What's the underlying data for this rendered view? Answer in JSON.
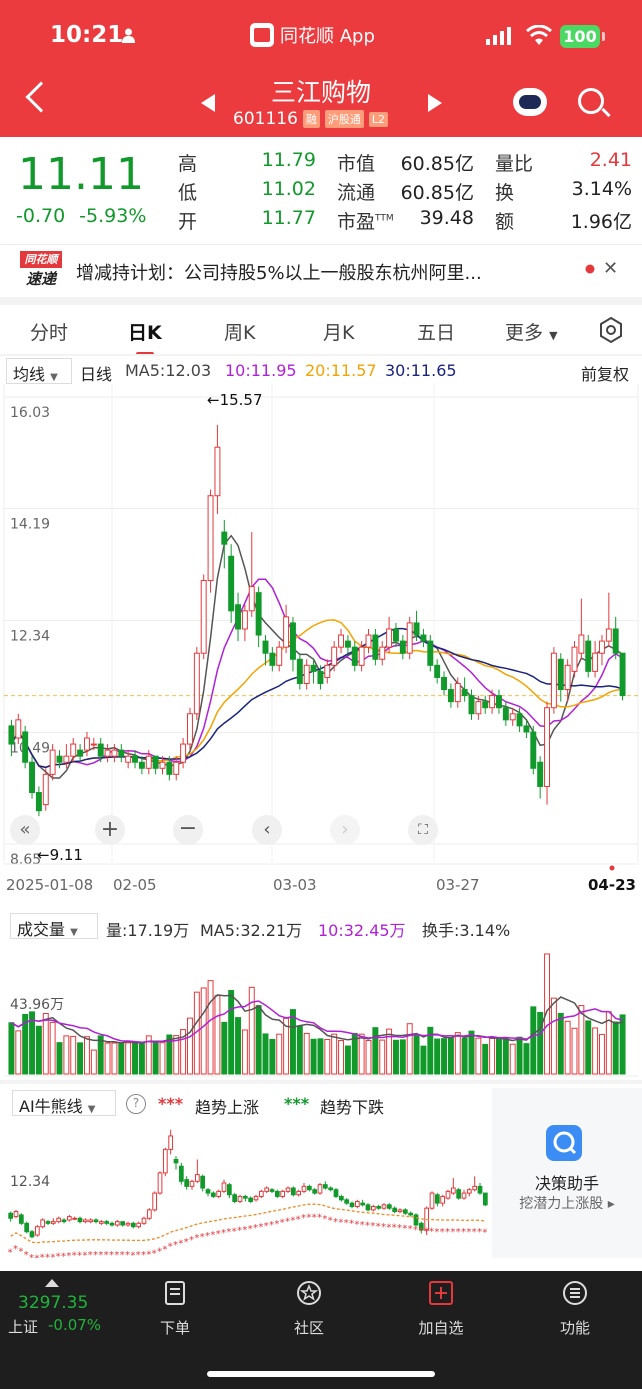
{
  "status_bar": {
    "time": "10:21",
    "app_name": "同花顺 App",
    "battery": "100"
  },
  "header": {
    "stock_name": "三江购物",
    "stock_code": "601116",
    "tags": [
      "融",
      "沪股通",
      "L2"
    ]
  },
  "quote": {
    "price": "11.11",
    "change": "-0.70",
    "change_pct": "-5.93%",
    "rows": [
      [
        {
          "l": "高",
          "v": "11.79",
          "c": "green"
        },
        {
          "l": "市值",
          "v": "60.85亿",
          "c": ""
        },
        {
          "l": "量比",
          "v": "2.41",
          "c": "red"
        }
      ],
      [
        {
          "l": "低",
          "v": "11.02",
          "c": "green"
        },
        {
          "l": "流通",
          "v": "60.85亿",
          "c": ""
        },
        {
          "l": "换",
          "v": "3.14%",
          "c": ""
        }
      ],
      [
        {
          "l": "开",
          "v": "11.77",
          "c": "green"
        },
        {
          "l": "市盈",
          "v": "39.48",
          "c": ""
        },
        {
          "l": "额",
          "v": "1.96亿",
          "c": ""
        }
      ]
    ],
    "pe_sup": "TTM"
  },
  "news": {
    "logo_top": "同花顺",
    "logo_bottom": "速递",
    "text": "增减持计划：公司持股5%以上一般股东杭州阿里..."
  },
  "tabs": [
    "分时",
    "日K",
    "周K",
    "月K",
    "五日",
    "更多"
  ],
  "ma": {
    "selector": "均线",
    "period": "日线",
    "ma5": "MA5:12.03",
    "ma10": "10:11.95",
    "ma20": "20:11.57",
    "ma30": "30:11.65",
    "adjust": "前复权"
  },
  "kline": {
    "y_labels": [
      "16.03",
      "14.19",
      "12.34",
      "10.49",
      "8.65"
    ],
    "max_label": "←15.57",
    "min_label": "←9.11",
    "dates": [
      "2025-01-08",
      "02-05",
      "03-03",
      "03-27",
      "04-23"
    ]
  },
  "volume": {
    "selector": "成交量",
    "amount": "量:17.19万",
    "ma5": "MA5:32.21万",
    "ma10": "10:32.45万",
    "turnover": "换手:3.14%",
    "y_label": "43.96万"
  },
  "ai": {
    "selector": "AI牛熊线",
    "up_marks": "***",
    "up": "趋势上涨",
    "down_marks": "***",
    "down": "趋势下跌",
    "y_label": "12.34",
    "assistant": "决策助手",
    "assistant_sub": "挖潜力上涨股"
  },
  "bottom": {
    "index_value": "3297.35",
    "index_name": "上证",
    "index_change": "-0.07%",
    "items": [
      "下单",
      "社区",
      "加自选",
      "功能"
    ]
  },
  "colors": {
    "up": "#e4393c",
    "down": "#119a2b",
    "ma5": "#555555",
    "ma10": "#b120d8",
    "ma20": "#f4a300",
    "ma30": "#1a237e"
  },
  "chart_data": {
    "type": "candlestick",
    "candles": [
      [
        10.6,
        10.3,
        10.7,
        10.1
      ],
      [
        10.4,
        10.7,
        10.8,
        10.3
      ],
      [
        10.5,
        10.0,
        10.6,
        9.9
      ],
      [
        10.0,
        9.5,
        10.1,
        9.4
      ],
      [
        9.5,
        9.2,
        9.6,
        9.11
      ],
      [
        9.3,
        9.8,
        9.9,
        9.2
      ],
      [
        9.8,
        10.2,
        10.3,
        9.7
      ],
      [
        10.1,
        10.0,
        10.2,
        9.9
      ],
      [
        10.0,
        10.1,
        10.3,
        9.9
      ],
      [
        10.1,
        10.3,
        10.4,
        10.0
      ],
      [
        10.2,
        10.1,
        10.3,
        10.0
      ],
      [
        10.2,
        10.4,
        10.5,
        10.1
      ],
      [
        10.3,
        10.3,
        10.4,
        10.2
      ],
      [
        10.3,
        10.1,
        10.4,
        10.0
      ],
      [
        10.1,
        10.2,
        10.3,
        10.0
      ],
      [
        10.1,
        10.2,
        10.3,
        10.0
      ],
      [
        10.2,
        10.1,
        10.3,
        10.0
      ],
      [
        10.0,
        10.1,
        10.2,
        9.9
      ],
      [
        10.1,
        10.0,
        10.2,
        9.9
      ],
      [
        10.0,
        9.9,
        10.1,
        9.8
      ],
      [
        9.9,
        10.1,
        10.2,
        9.8
      ],
      [
        10.1,
        9.9,
        10.1,
        9.8
      ],
      [
        9.9,
        10.0,
        10.1,
        9.8
      ],
      [
        10.0,
        9.8,
        10.1,
        9.7
      ],
      [
        9.8,
        10.0,
        10.1,
        9.7
      ],
      [
        10.0,
        10.3,
        10.4,
        9.9
      ],
      [
        10.3,
        10.8,
        10.9,
        10.2
      ],
      [
        10.8,
        11.8,
        11.9,
        10.7
      ],
      [
        11.8,
        13.0,
        13.1,
        11.7
      ],
      [
        13.0,
        14.4,
        14.5,
        12.8
      ],
      [
        14.4,
        15.2,
        15.57,
        14.1
      ],
      [
        13.8,
        13.6,
        14.0,
        13.2
      ],
      [
        13.4,
        12.5,
        13.6,
        12.3
      ],
      [
        12.6,
        12.2,
        12.8,
        12.0
      ],
      [
        12.2,
        12.5,
        12.6,
        12.0
      ],
      [
        12.5,
        12.9,
        13.8,
        12.4
      ],
      [
        12.8,
        12.1,
        12.9,
        11.9
      ],
      [
        12.0,
        11.8,
        12.1,
        11.6
      ],
      [
        11.8,
        11.6,
        11.9,
        11.5
      ],
      [
        11.6,
        11.9,
        12.0,
        11.5
      ],
      [
        11.9,
        12.4,
        12.6,
        11.8
      ],
      [
        12.3,
        11.7,
        12.4,
        11.5
      ],
      [
        11.7,
        11.3,
        11.8,
        11.2
      ],
      [
        11.3,
        11.6,
        11.7,
        11.2
      ],
      [
        11.6,
        11.5,
        11.7,
        11.3
      ],
      [
        11.5,
        11.3,
        11.6,
        11.2
      ],
      [
        11.4,
        11.6,
        11.7,
        11.3
      ],
      [
        11.6,
        11.9,
        12.0,
        11.5
      ],
      [
        11.9,
        12.1,
        12.2,
        11.8
      ],
      [
        12.0,
        11.9,
        12.1,
        11.8
      ],
      [
        11.9,
        11.6,
        12.0,
        11.5
      ],
      [
        11.6,
        11.9,
        12.0,
        11.5
      ],
      [
        11.9,
        12.1,
        12.2,
        11.8
      ],
      [
        12.1,
        11.7,
        12.2,
        11.6
      ],
      [
        11.7,
        11.9,
        12.0,
        11.6
      ],
      [
        11.9,
        12.2,
        12.4,
        11.8
      ],
      [
        12.2,
        12.0,
        12.3,
        11.9
      ],
      [
        12.0,
        11.8,
        12.1,
        11.7
      ],
      [
        11.8,
        12.3,
        12.4,
        11.7
      ],
      [
        12.3,
        12.1,
        12.5,
        12.0
      ],
      [
        12.1,
        12.0,
        12.2,
        11.9
      ],
      [
        12.0,
        11.6,
        12.1,
        11.5
      ],
      [
        11.6,
        11.4,
        11.7,
        11.3
      ],
      [
        11.4,
        11.2,
        11.5,
        11.1
      ],
      [
        11.2,
        11.0,
        11.3,
        10.9
      ],
      [
        11.0,
        11.3,
        11.4,
        10.9
      ],
      [
        11.2,
        11.1,
        11.4,
        11.0
      ],
      [
        11.1,
        10.8,
        11.2,
        10.7
      ],
      [
        10.8,
        11.0,
        11.1,
        10.7
      ],
      [
        11.0,
        10.9,
        11.1,
        10.8
      ],
      [
        10.9,
        11.1,
        11.2,
        10.8
      ],
      [
        11.1,
        10.9,
        11.2,
        10.8
      ],
      [
        10.9,
        10.7,
        11.0,
        10.6
      ],
      [
        10.7,
        10.8,
        10.9,
        10.6
      ],
      [
        10.8,
        10.6,
        10.9,
        10.5
      ],
      [
        10.6,
        10.5,
        10.7,
        10.4
      ],
      [
        10.5,
        9.9,
        10.6,
        9.8
      ],
      [
        10.0,
        9.6,
        10.1,
        9.4
      ],
      [
        9.6,
        10.9,
        11.0,
        9.3
      ],
      [
        10.9,
        11.8,
        11.9,
        10.8
      ],
      [
        11.7,
        11.2,
        11.8,
        11.0
      ],
      [
        11.2,
        11.6,
        11.7,
        11.0
      ],
      [
        11.5,
        11.9,
        12.0,
        11.4
      ],
      [
        11.8,
        12.1,
        12.7,
        11.7
      ],
      [
        12.0,
        11.5,
        12.1,
        11.4
      ],
      [
        11.5,
        11.8,
        12.0,
        11.4
      ],
      [
        11.8,
        12.0,
        12.1,
        11.6
      ],
      [
        12.0,
        12.2,
        12.8,
        11.9
      ],
      [
        12.2,
        11.8,
        12.4,
        11.7
      ],
      [
        11.8,
        11.1,
        11.79,
        11.02
      ]
    ],
    "volume_axis_label": "43.96万"
  }
}
